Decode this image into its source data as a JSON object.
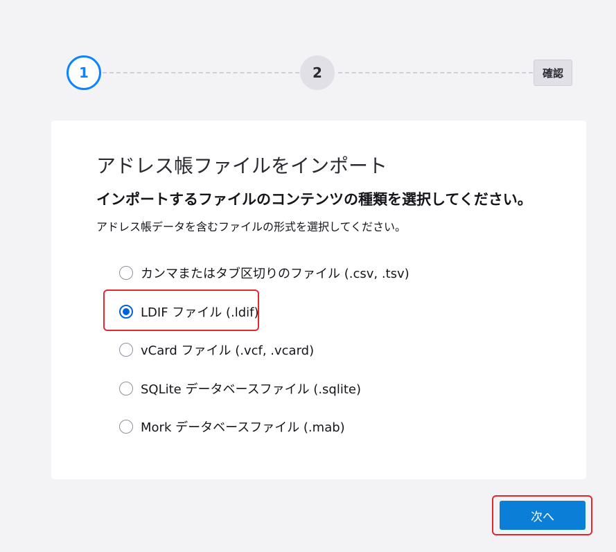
{
  "stepper": {
    "step1": "1",
    "step2": "2",
    "confirm": "確認"
  },
  "card": {
    "title": "アドレス帳ファイルをインポート",
    "heading": "インポートするファイルのコンテンツの種類を選択してください。",
    "description": "アドレス帳データを含むファイルの形式を選択してください。",
    "options": [
      {
        "label": "カンマまたはタブ区切りのファイル (.csv, .tsv)",
        "checked": false
      },
      {
        "label": "LDIF ファイル (.ldif)",
        "checked": true
      },
      {
        "label": "vCard ファイル (.vcf, .vcard)",
        "checked": false
      },
      {
        "label": "SQLite データベースファイル (.sqlite)",
        "checked": false
      },
      {
        "label": "Mork データベースファイル (.mab)",
        "checked": false
      }
    ]
  },
  "footer": {
    "next_label": "次へ"
  },
  "colors": {
    "accent": "#0b84ff",
    "primary_button": "#0b7fd8",
    "highlight_box": "#e0282e"
  }
}
